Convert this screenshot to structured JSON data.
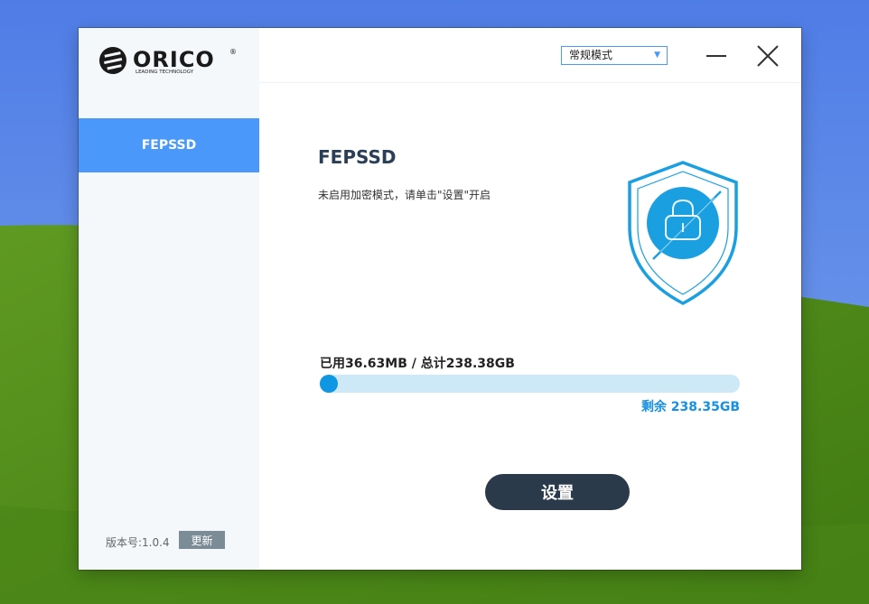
{
  "app": {
    "brand": "ORICO",
    "brand_tagline": "LEADING TECHNOLOGY"
  },
  "topbar": {
    "mode_value": "常规模式"
  },
  "sidebar": {
    "items": [
      {
        "label": "FEPSSD",
        "active": true
      }
    ],
    "version_label": "版本号:1.0.4",
    "update_label": "更新"
  },
  "main": {
    "title": "FEPSSD",
    "hint": "未启用加密模式，请单击\"设置\"开启",
    "usage_text": "已用36.63MB / 总计238.38GB",
    "used_fraction": 0.00015,
    "remaining_text": "剩余 238.35GB",
    "settings_label": "设置"
  },
  "colors": {
    "accent": "#4a98fa",
    "progress": "#0f97e3",
    "progress_track": "#cde9f8",
    "button_dark": "#2b3a4a",
    "shield": "#1aa0e0"
  },
  "icons": {
    "logo": "orico-logo",
    "shield": "shield-lock-icon",
    "minimize": "minimize-icon",
    "close": "close-icon",
    "dropdown": "chevron-down-icon"
  }
}
